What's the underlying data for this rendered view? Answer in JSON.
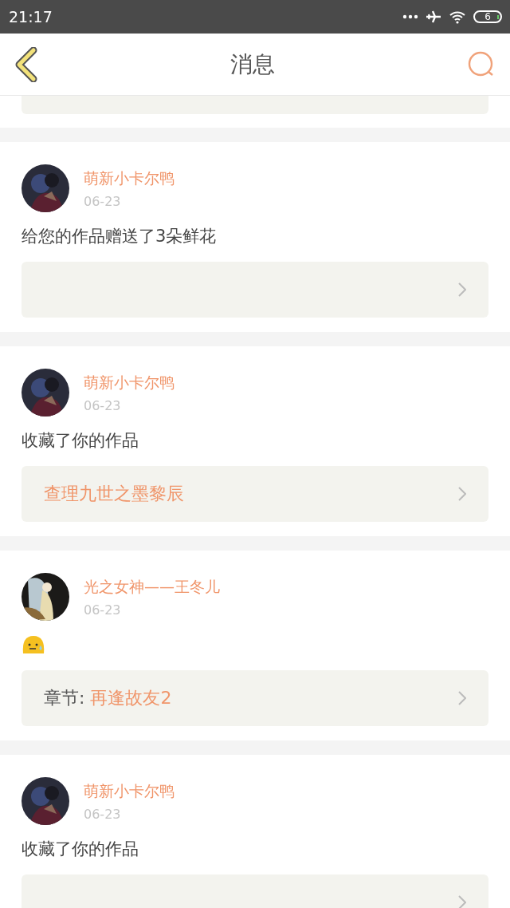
{
  "status_bar": {
    "time": "21:17",
    "battery": "6"
  },
  "header": {
    "title": "消息"
  },
  "messages": [
    {
      "link": {
        "kind": "empty"
      }
    },
    {
      "author": "萌新小卡尔鸭",
      "date": "06-23",
      "body": {
        "kind": "text",
        "text": "给您的作品赠送了3朵鲜花"
      },
      "link": {
        "kind": "empty"
      }
    },
    {
      "author": "萌新小卡尔鸭",
      "date": "06-23",
      "body": {
        "kind": "text",
        "text": "收藏了你的作品"
      },
      "link": {
        "kind": "work",
        "title": "查理九世之墨黎辰"
      }
    },
    {
      "author": "光之女神——王冬儿",
      "date": "06-23",
      "body": {
        "kind": "emoji"
      },
      "link": {
        "kind": "chapter",
        "label": "章节:",
        "title": "再逢故友2"
      }
    },
    {
      "author": "萌新小卡尔鸭",
      "date": "06-23",
      "body": {
        "kind": "text",
        "text": "收藏了你的作品"
      },
      "link": {
        "kind": "empty"
      }
    }
  ]
}
